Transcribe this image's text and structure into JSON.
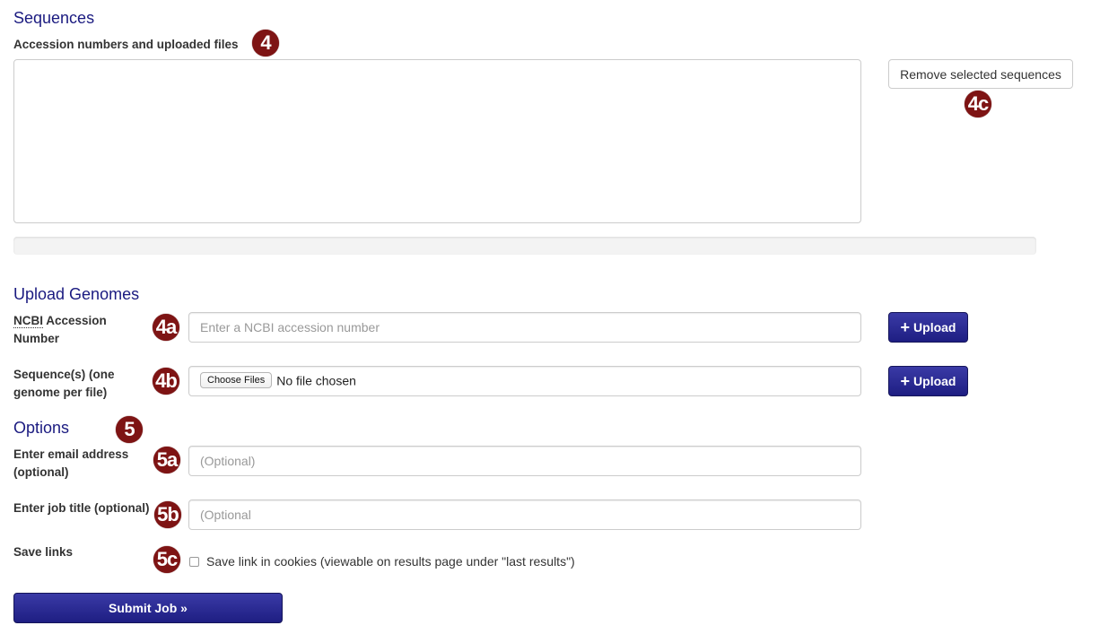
{
  "sequences": {
    "heading": "Sequences",
    "list_label": "Accession numbers and uploaded files",
    "list_badge": "4",
    "remove_button": "Remove selected sequences",
    "remove_badge": "4c",
    "progress": 0
  },
  "upload": {
    "heading": "Upload Genomes",
    "ncbi": {
      "label_abbr": "NCBI",
      "label_rest": " Accession",
      "label_line2": "Number",
      "badge": "4a",
      "placeholder": "Enter a NCBI accession number",
      "value": "",
      "button": "Upload",
      "button_icon": "+"
    },
    "file": {
      "label_line1": "Sequence(s) (one",
      "label_line2": "genome per file)",
      "badge": "4b",
      "choose_button": "Choose Files",
      "status": "No file chosen",
      "button": "Upload",
      "button_icon": "+"
    }
  },
  "options": {
    "heading": "Options",
    "badge": "5",
    "email": {
      "label_line1": "Enter email address",
      "label_line2": "(optional)",
      "badge": "5a",
      "placeholder": "(Optional)",
      "value": ""
    },
    "job_title": {
      "label": "Enter job title (optional)",
      "badge": "5b",
      "placeholder": "(Optional",
      "value": ""
    },
    "save_links": {
      "label": "Save links",
      "badge": "5c",
      "checkbox_label": "Save link in cookies (viewable on results page under \"last results\")",
      "checked": false
    }
  },
  "submit": {
    "label": "Submit Job »"
  },
  "colors": {
    "heading": "#1a1a80",
    "badge": "#7e1414",
    "primary_button": "#2a2a94"
  }
}
